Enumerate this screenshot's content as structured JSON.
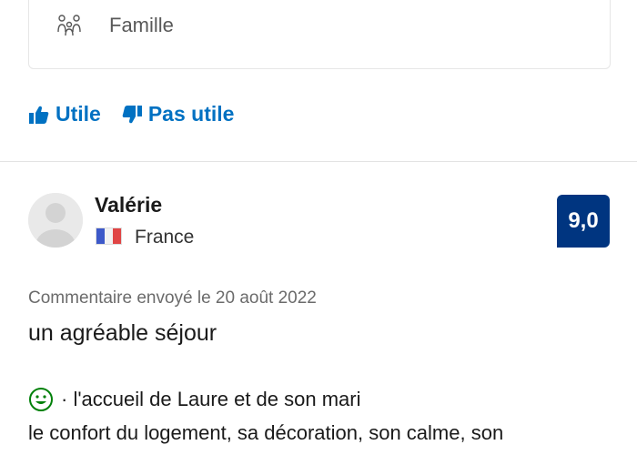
{
  "traveler": {
    "type_label": "Famille",
    "icon": "family-icon"
  },
  "votes": {
    "helpful_label": "Utile",
    "not_helpful_label": "Pas utile"
  },
  "review": {
    "reviewer_name": "Valérie",
    "country": "France",
    "score": "9,0",
    "date_text": "Commentaire envoyé le 20 août 2022",
    "title": "un agréable séjour",
    "positive_line": "· l'accueil de Laure et de son mari",
    "body_line": "le confort du logement, sa décoration, son calme, son"
  },
  "colors": {
    "link_blue": "#0071c2",
    "score_bg": "#003580",
    "positive_green": "#008009",
    "muted_text": "#6b6b6b"
  }
}
